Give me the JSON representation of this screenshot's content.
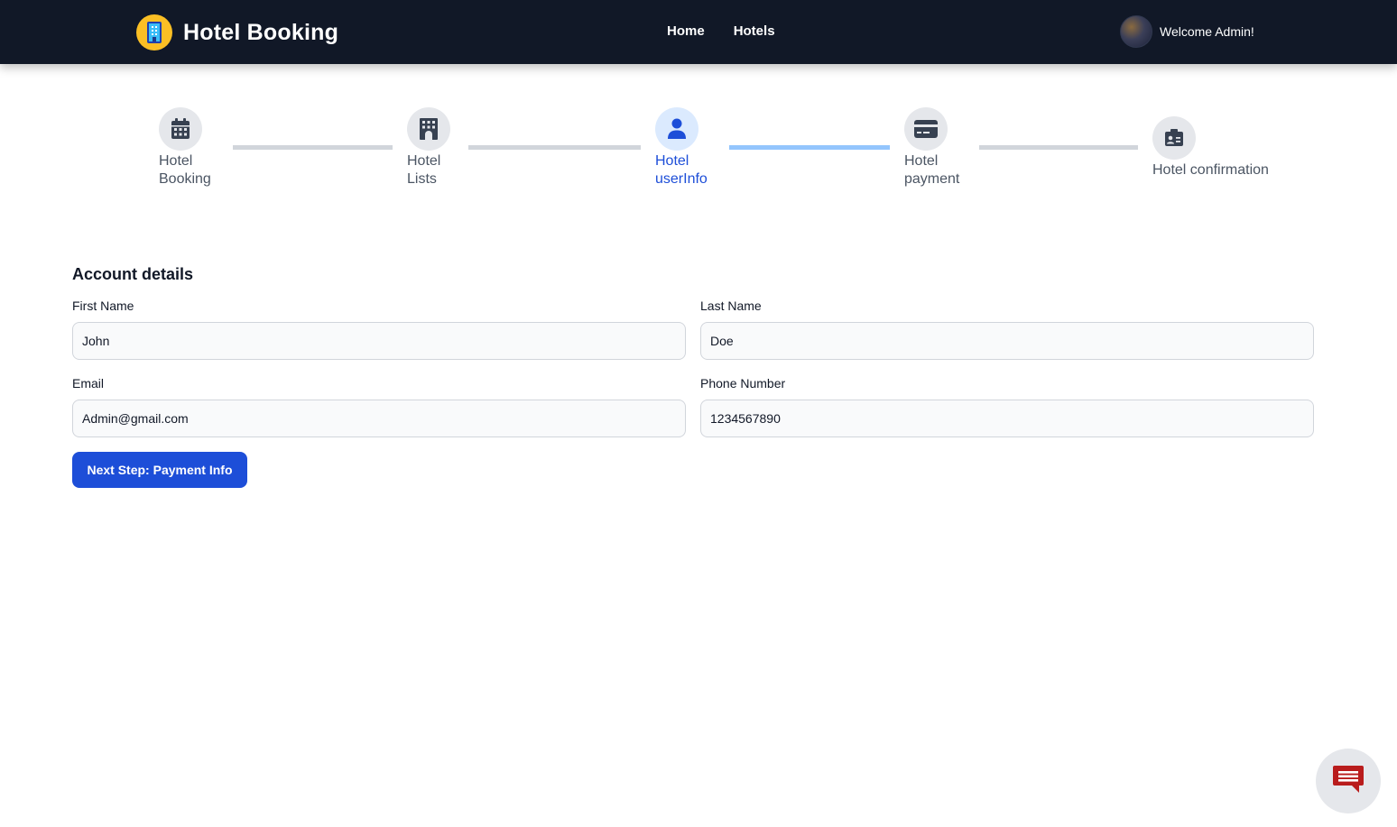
{
  "header": {
    "brand_title": "Hotel Booking",
    "nav": [
      {
        "label": "Home"
      },
      {
        "label": "Hotels"
      }
    ],
    "welcome_text": "Welcome Admin!"
  },
  "stepper": {
    "active_index": 2,
    "steps": [
      {
        "line1": "Hotel",
        "line2": "Booking",
        "icon": "calendar-icon"
      },
      {
        "line1": "Hotel",
        "line2": "Lists",
        "icon": "building-icon"
      },
      {
        "line1": "Hotel",
        "line2": "userInfo",
        "icon": "user-icon"
      },
      {
        "line1": "Hotel",
        "line2": "payment",
        "icon": "credit-card-icon"
      },
      {
        "line1": "Hotel confirmation",
        "line2": "",
        "icon": "id-card-icon"
      }
    ]
  },
  "form": {
    "title": "Account details",
    "first_name": {
      "label": "First Name",
      "value": "John"
    },
    "last_name": {
      "label": "Last Name",
      "value": "Doe"
    },
    "email": {
      "label": "Email",
      "value": "Admin@gmail.com"
    },
    "phone": {
      "label": "Phone Number",
      "value": "1234567890"
    },
    "submit_label": "Next Step: Payment Info"
  },
  "colors": {
    "navbar_bg": "#111827",
    "accent": "#1d4ed8",
    "active_connector": "#93c5fd",
    "inactive_connector": "#d1d5db",
    "chat_icon": "#b91c1c"
  }
}
